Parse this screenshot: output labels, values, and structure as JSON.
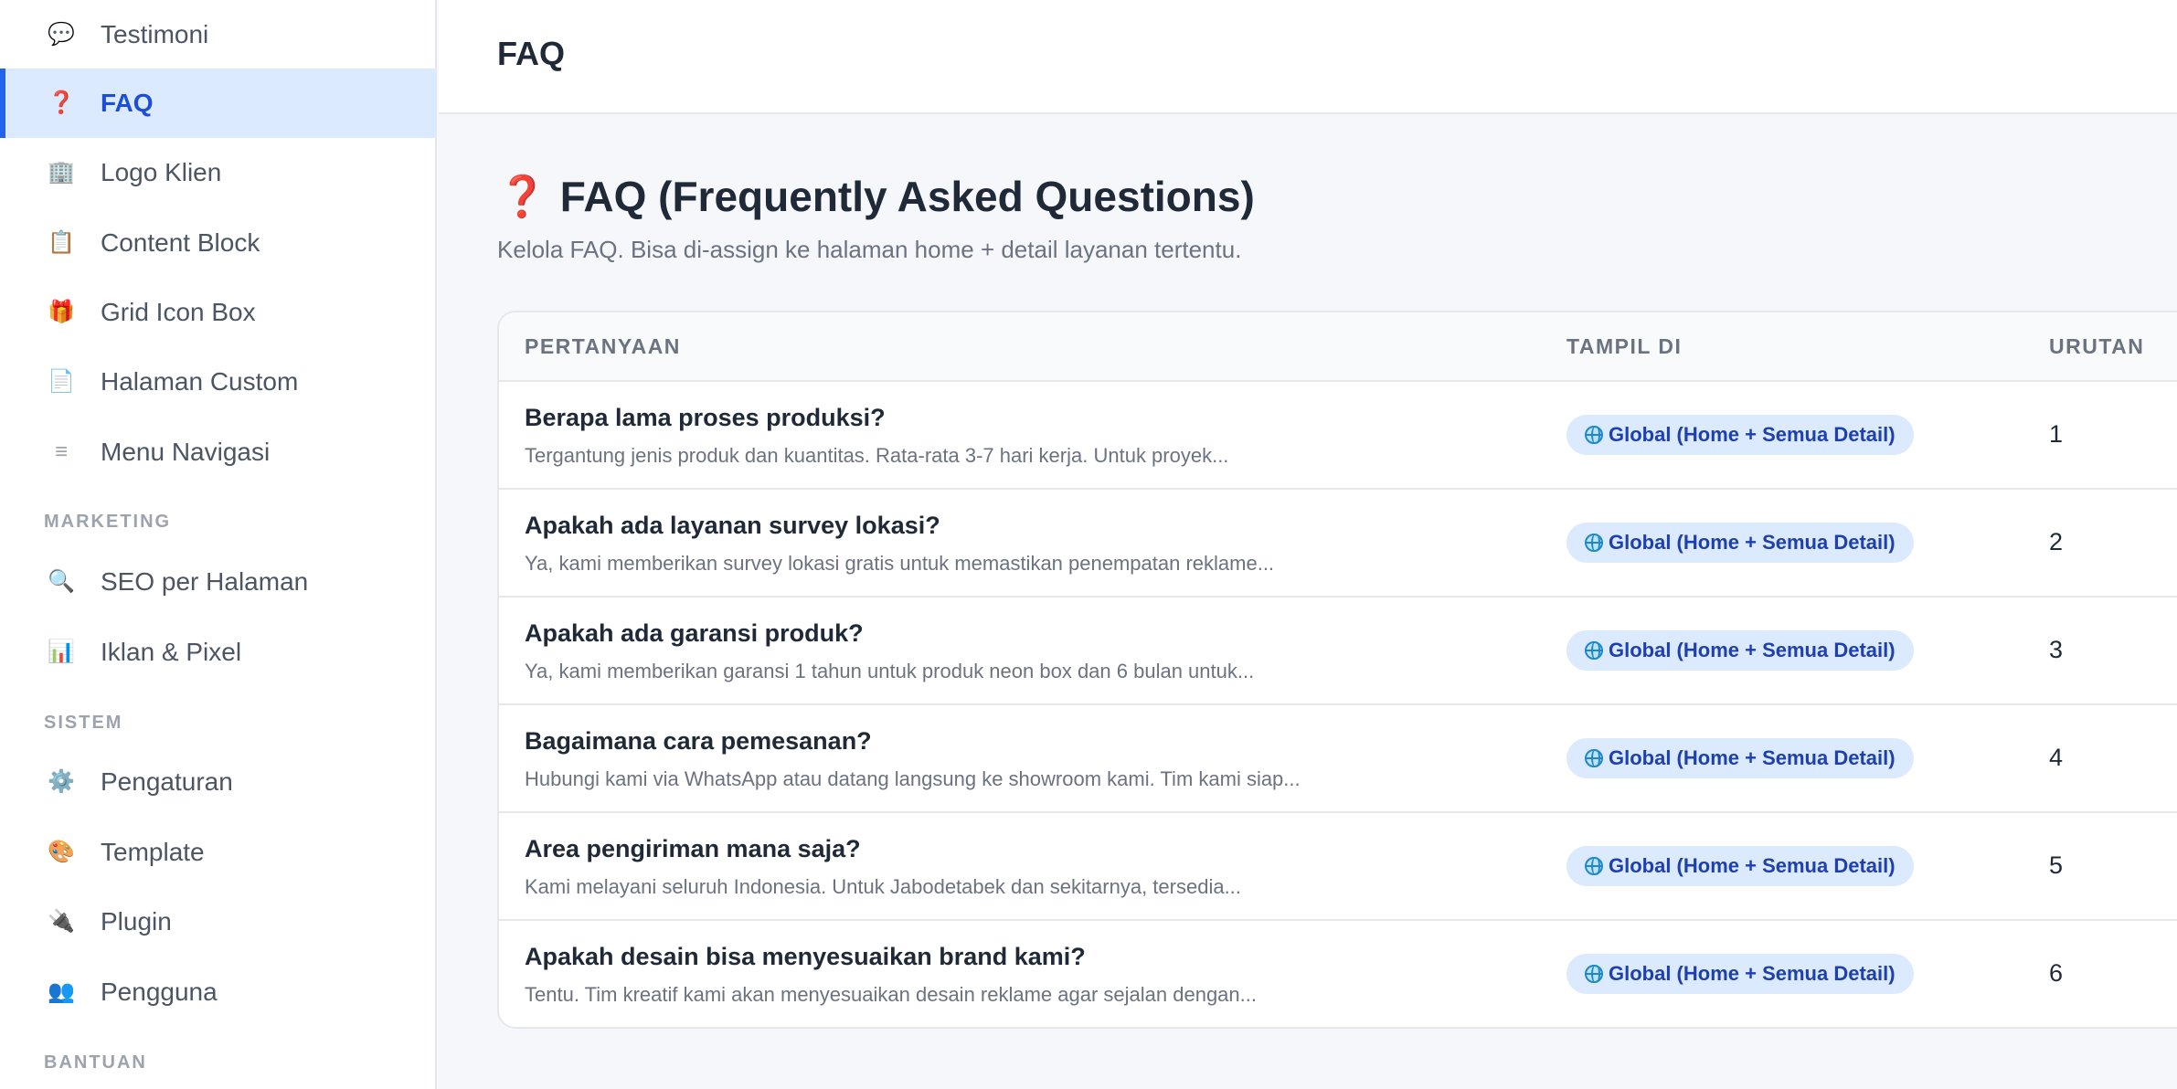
{
  "sidebar": {
    "items": [
      {
        "label": "Testimoni",
        "icon": "💬",
        "icon_name": "speech-bubble-icon",
        "active": false
      },
      {
        "label": "FAQ",
        "icon": "❓",
        "icon_name": "question-mark-icon",
        "active": true
      },
      {
        "label": "Logo Klien",
        "icon": "🏢",
        "icon_name": "office-building-icon",
        "active": false
      },
      {
        "label": "Content Block",
        "icon": "📋",
        "icon_name": "clipboard-icon",
        "active": false
      },
      {
        "label": "Grid Icon Box",
        "icon": "🎁",
        "icon_name": "gift-icon",
        "active": false
      },
      {
        "label": "Halaman Custom",
        "icon": "📄",
        "icon_name": "page-icon",
        "active": false
      },
      {
        "label": "Menu Navigasi",
        "icon": "≡",
        "icon_name": "menu-lines-icon",
        "active": false
      }
    ],
    "sections": {
      "marketing": "MARKETING",
      "sistem": "SISTEM",
      "bantuan": "BANTUAN"
    },
    "marketing_items": [
      {
        "label": "SEO per Halaman",
        "icon": "🔍",
        "icon_name": "magnifier-icon"
      },
      {
        "label": "Iklan & Pixel",
        "icon": "📊",
        "icon_name": "bar-chart-icon"
      }
    ],
    "sistem_items": [
      {
        "label": "Pengaturan",
        "icon": "⚙️",
        "icon_name": "gear-icon"
      },
      {
        "label": "Template",
        "icon": "🎨",
        "icon_name": "palette-icon"
      },
      {
        "label": "Plugin",
        "icon": "🔌",
        "icon_name": "plug-icon"
      },
      {
        "label": "Pengguna",
        "icon": "👥",
        "icon_name": "users-icon"
      }
    ]
  },
  "header": {
    "title": "FAQ"
  },
  "main": {
    "title_icon": "❓",
    "title": "FAQ (Frequently Asked Questions)",
    "subtitle": "Kelola FAQ. Bisa di-assign ke halaman home + detail layanan tertentu.",
    "columns": [
      "PERTANYAAN",
      "TAMPIL DI",
      "URUTAN"
    ],
    "rows": [
      {
        "question": "Berapa lama proses produksi?",
        "answer": "Tergantung jenis produk dan kuantitas. Rata-rata 3-7 hari kerja. Untuk proyek...",
        "scope": "Global (Home + Semua Detail)",
        "order": "1"
      },
      {
        "question": "Apakah ada layanan survey lokasi?",
        "answer": "Ya, kami memberikan survey lokasi gratis untuk memastikan penempatan reklame...",
        "scope": "Global (Home + Semua Detail)",
        "order": "2"
      },
      {
        "question": "Apakah ada garansi produk?",
        "answer": "Ya, kami memberikan garansi 1 tahun untuk produk neon box dan 6 bulan untuk...",
        "scope": "Global (Home + Semua Detail)",
        "order": "3"
      },
      {
        "question": "Bagaimana cara pemesanan?",
        "answer": "Hubungi kami via WhatsApp atau datang langsung ke showroom kami. Tim kami siap...",
        "scope": "Global (Home + Semua Detail)",
        "order": "4"
      },
      {
        "question": "Area pengiriman mana saja?",
        "answer": "Kami melayani seluruh Indonesia. Untuk Jabodetabek dan sekitarnya, tersedia...",
        "scope": "Global (Home + Semua Detail)",
        "order": "5"
      },
      {
        "question": "Apakah desain bisa menyesuaikan brand kami?",
        "answer": "Tentu. Tim kreatif kami akan menyesuaikan desain reklame agar sejalan dengan...",
        "scope": "Global (Home + Semua Detail)",
        "order": "6"
      }
    ]
  },
  "colors": {
    "accent": "#2563eb",
    "active_bg": "#dbeafe",
    "badge_text": "#1e40af",
    "question_red": "#dc2626"
  }
}
